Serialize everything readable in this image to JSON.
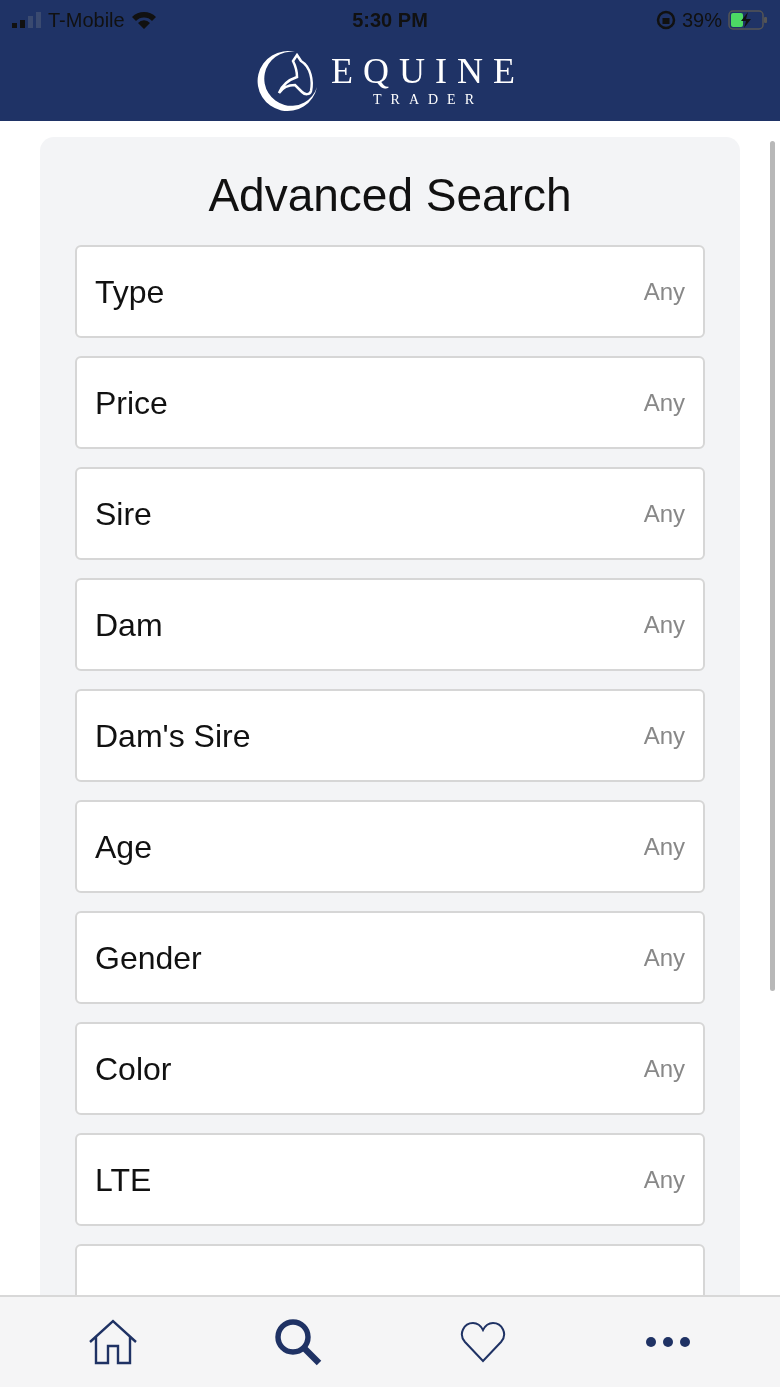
{
  "status_bar": {
    "carrier": "T-Mobile",
    "time": "5:30 PM",
    "battery_percent": "39%"
  },
  "header": {
    "brand": "EQUINE",
    "brand_sub": "TRADER"
  },
  "title": "Advanced Search",
  "filters": [
    {
      "label": "Type",
      "value": "Any"
    },
    {
      "label": "Price",
      "value": "Any"
    },
    {
      "label": "Sire",
      "value": "Any"
    },
    {
      "label": "Dam",
      "value": "Any"
    },
    {
      "label": "Dam's Sire",
      "value": "Any"
    },
    {
      "label": "Age",
      "value": "Any"
    },
    {
      "label": "Gender",
      "value": "Any"
    },
    {
      "label": "Color",
      "value": "Any"
    },
    {
      "label": "LTE",
      "value": "Any"
    }
  ],
  "more_rows_below": true,
  "tab_bar": [
    {
      "kind": "home",
      "selected": false
    },
    {
      "kind": "search",
      "selected": true
    },
    {
      "kind": "favorites",
      "selected": false
    },
    {
      "kind": "more",
      "selected": false
    }
  ]
}
